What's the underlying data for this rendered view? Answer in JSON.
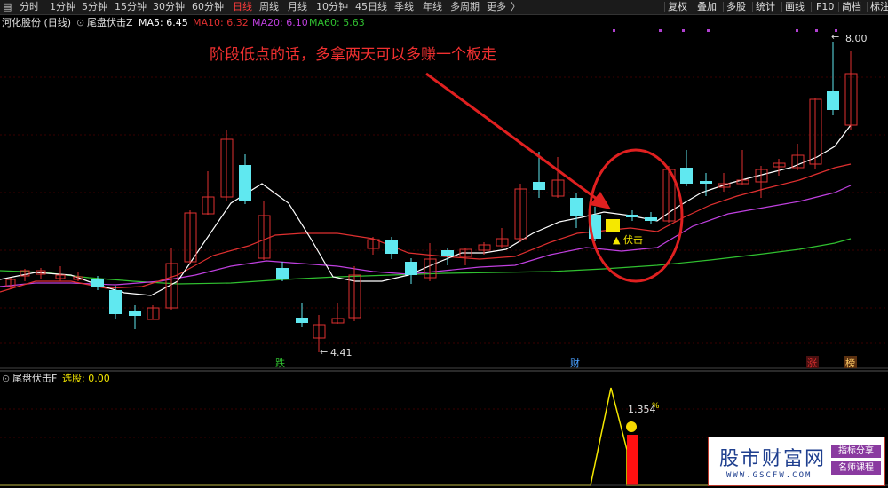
{
  "toolbar": {
    "left": [
      "分时",
      "1分钟",
      "5分钟",
      "15分钟",
      "30分钟",
      "60分钟",
      "日线",
      "周线",
      "月线",
      "10分钟",
      "45日线",
      "季线",
      "年线",
      "多周期",
      "更多"
    ],
    "active": "日线",
    "more_arrow": "〉",
    "right": [
      "复权",
      "叠加",
      "多股",
      "统计",
      "画线",
      "F10",
      "简档",
      "标注"
    ]
  },
  "main": {
    "stock": "河化股份 (日线)",
    "indicator": "尾盘伏击Z",
    "ma": [
      {
        "label": "MA5: 6.45",
        "color": "#ffffff"
      },
      {
        "label": "MA10: 6.32",
        "color": "#e03030"
      },
      {
        "label": "MA20: 6.10",
        "color": "#c040e0"
      },
      {
        "label": "MA60: 5.63",
        "color": "#30c030"
      }
    ],
    "annotation": "阶段低点的话，多拿两天可以多赚一个板走",
    "high_label": "8.00",
    "low_label": "4.41",
    "signal_label": "伏击",
    "markers": [
      {
        "text": "跌",
        "color": "#30c030"
      },
      {
        "text": "财",
        "color": "#4aa0ff"
      },
      {
        "text": "涨",
        "color": "#e03030"
      },
      {
        "text": "榜",
        "color": "#ffcc66"
      }
    ]
  },
  "sub": {
    "indicator": "尾盘伏击F",
    "value_label": "选股: 0.00",
    "peak_label": "1.354",
    "pct": "%"
  },
  "watermark": {
    "title": "股市财富网",
    "url": "WWW.GSCFW.COM",
    "tag1": "指标分享",
    "tag2": "名师课程"
  },
  "colors": {
    "up": "#e03030",
    "down": "#60e8f0",
    "ma5": "#ffffff",
    "ma10": "#e03030",
    "ma20": "#c040e0",
    "ma60": "#30c030"
  }
}
